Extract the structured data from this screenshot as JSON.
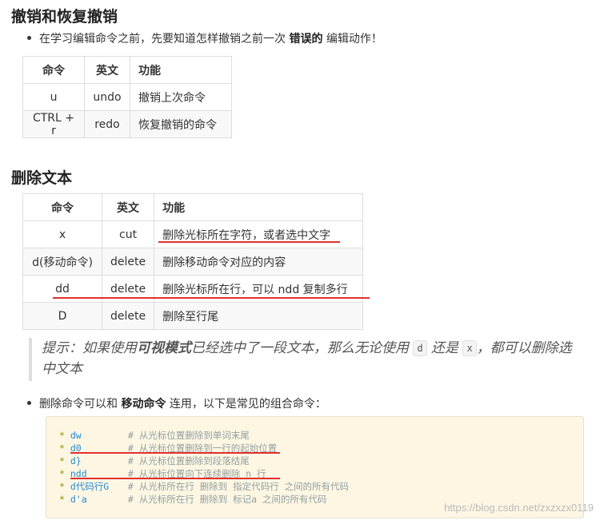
{
  "section1": {
    "title": "撤销和恢复撤销",
    "bullet_pre": "在学习编辑命令之前，先要知道怎样撤销之前一次",
    "bullet_bold": "错误的",
    "bullet_post": "编辑动作！",
    "headers": [
      "命令",
      "英文",
      "功能"
    ],
    "rows": [
      [
        "u",
        "undo",
        "撤销上次命令"
      ],
      [
        "CTRL + r",
        "redo",
        "恢复撤销的命令"
      ]
    ]
  },
  "section2": {
    "title": "删除文本",
    "headers": [
      "命令",
      "英文",
      "功能"
    ],
    "rows": [
      [
        "x",
        "cut",
        "删除光标所在字符，或者选中文字"
      ],
      [
        "d(移动命令)",
        "delete",
        "删除移动命令对应的内容"
      ],
      [
        "dd",
        "delete",
        "删除光标所在行，可以 ndd 复制多行"
      ],
      [
        "D",
        "delete",
        "删除至行尾"
      ]
    ]
  },
  "tip": {
    "pre": "提示：如果使用",
    "bold": "可视模式",
    "mid": "已经选中了一段文本，那么无论使用",
    "code1": "d",
    "mid2": "还是",
    "code2": "x",
    "post": "，都可以删除选中文本"
  },
  "bullet2": {
    "pre": "删除命令可以和",
    "bold": "移动命令",
    "post": "连用，以下是常见的组合命令："
  },
  "code_lines": [
    {
      "star": "*",
      "cmd": "dw",
      "comment": "# 从光标位置删除到单词末尾"
    },
    {
      "star": "*",
      "cmd": "d0",
      "comment": "# 从光标位置删除到一行的起始位置"
    },
    {
      "star": "*",
      "cmd": "d}",
      "comment": "# 从光标位置删除到段落结尾"
    },
    {
      "star": "*",
      "cmd": "ndd",
      "comment": "# 从光标位置向下连续删除 n 行"
    },
    {
      "star": "*",
      "cmd": "d代码行G",
      "comment": "# 从光标所在行 删除到 指定代码行 之间的所有代码"
    },
    {
      "star": "*",
      "cmd": "d'a",
      "comment": "# 从光标所在行 删除到 标记a 之间的所有代码"
    }
  ],
  "watermark": "https://blog.csdn.net/zxzxzx0119",
  "colors": {
    "underline": "#e0302e",
    "code_bg": "#fdf6e3"
  }
}
